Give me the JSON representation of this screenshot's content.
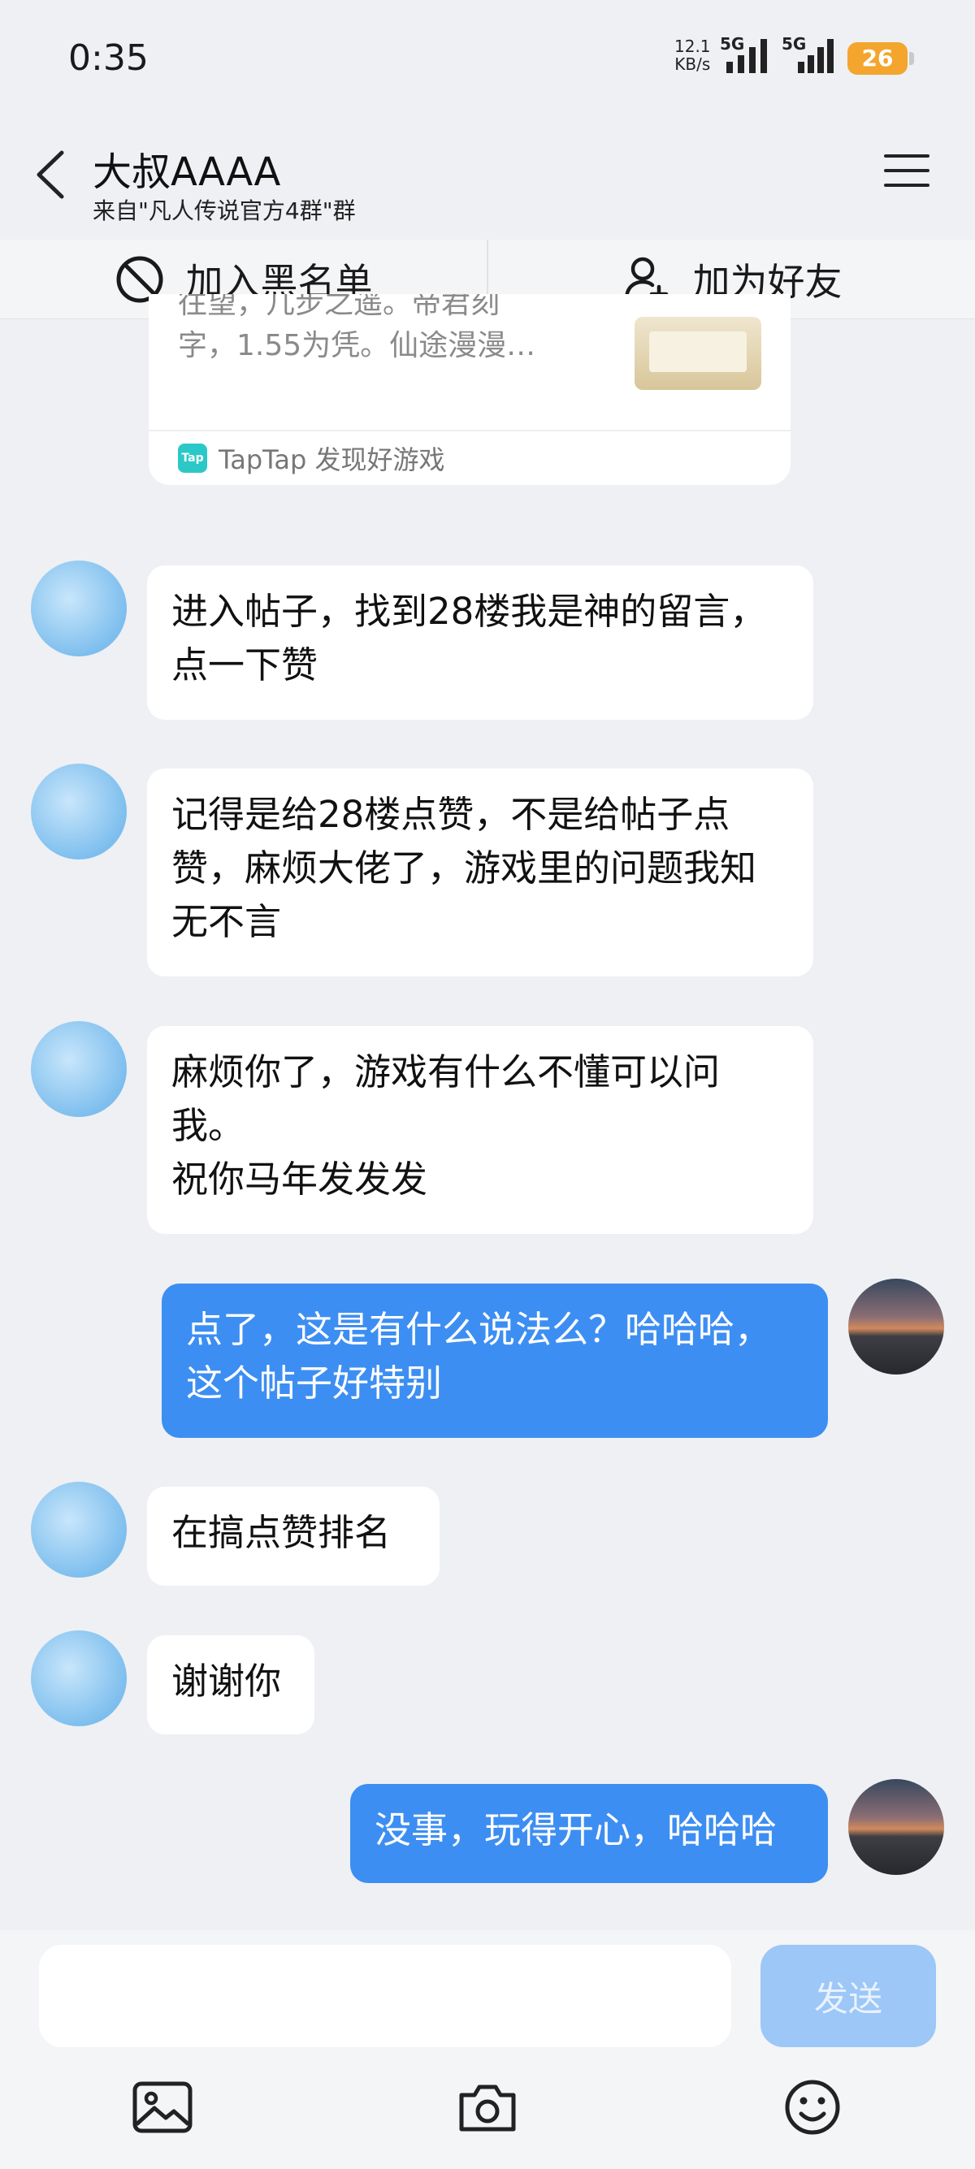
{
  "status": {
    "time": "0:35",
    "net_speed_value": "12.1",
    "net_speed_unit": "KB/s",
    "signal1": "5G",
    "signal2": "5G",
    "battery": "26"
  },
  "header": {
    "title": "大叔AAAA",
    "subtitle": "来自\"凡人传说官方4群\"群"
  },
  "actions": {
    "blacklist": "加入黑名单",
    "add_friend": "加为好友"
  },
  "card": {
    "text_line1": "往望，几步之遥。帝君刻",
    "text_line2": "字，1.55为凭。仙途漫漫…",
    "source": "TapTap 发现好游戏",
    "logo": "Tap"
  },
  "messages": [
    {
      "side": "them",
      "text": "进入帖子，找到28楼我是神的留言，点一下赞"
    },
    {
      "side": "them",
      "text": "记得是给28楼点赞，不是给帖子点赞，麻烦大佬了，游戏里的问题我知无不言"
    },
    {
      "side": "them",
      "text": "麻烦你了，游戏有什么不懂可以问我。\n祝你马年发发发"
    },
    {
      "side": "me",
      "text": "点了，这是有什么说法么？哈哈哈，这个帖子好特别"
    },
    {
      "side": "them",
      "text": "在搞点赞排名"
    },
    {
      "side": "them",
      "text": "谢谢你"
    },
    {
      "side": "me",
      "text": "没事，玩得开心，哈哈哈"
    }
  ],
  "input": {
    "placeholder": "",
    "send_label": "发送"
  },
  "icons": [
    "back-arrow-icon",
    "menu-icon",
    "block-icon",
    "add-user-icon",
    "image-icon",
    "camera-icon",
    "emoji-icon"
  ]
}
